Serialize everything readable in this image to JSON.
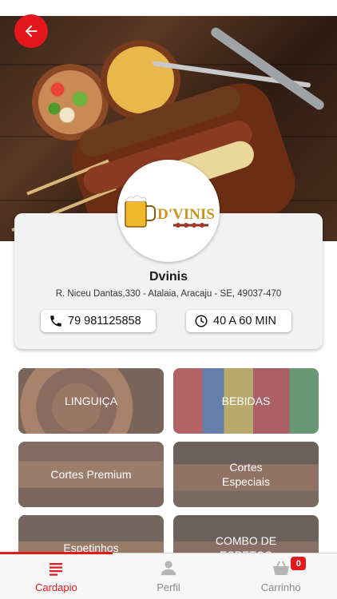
{
  "header": {
    "back_icon": "arrow-left-icon",
    "hero_image": "grilled-meat-skewers-photo"
  },
  "store": {
    "logo_text": "D'VINIS",
    "name": "Dvinis",
    "address": "R. Niceu Dantas,330 - Atalaia, Aracaju - SE, 49037-470",
    "phone": "79 981125858",
    "delivery_time": "40 A 60 MIN",
    "phone_icon": "phone-icon",
    "clock_icon": "clock-icon"
  },
  "categories": [
    {
      "label": "LINGUIÇA"
    },
    {
      "label": "BEBIDAS"
    },
    {
      "label": "Cortes Premium"
    },
    {
      "label": "Cortes\nEspeciais"
    },
    {
      "label": "Espetinhos"
    },
    {
      "label": "COMBO DE\nESPETOS"
    }
  ],
  "tab_bar": {
    "tabs": [
      {
        "label": "Cardapio",
        "icon": "menu-list-icon",
        "active": true
      },
      {
        "label": "Perfil",
        "icon": "user-icon",
        "active": false
      },
      {
        "label": "Carrinho",
        "icon": "basket-icon",
        "active": false
      }
    ],
    "cart_count": "0"
  },
  "colors": {
    "accent": "#e3181d",
    "card_bg": "#f2f2f2",
    "tab_inactive": "#8a8a8a"
  }
}
